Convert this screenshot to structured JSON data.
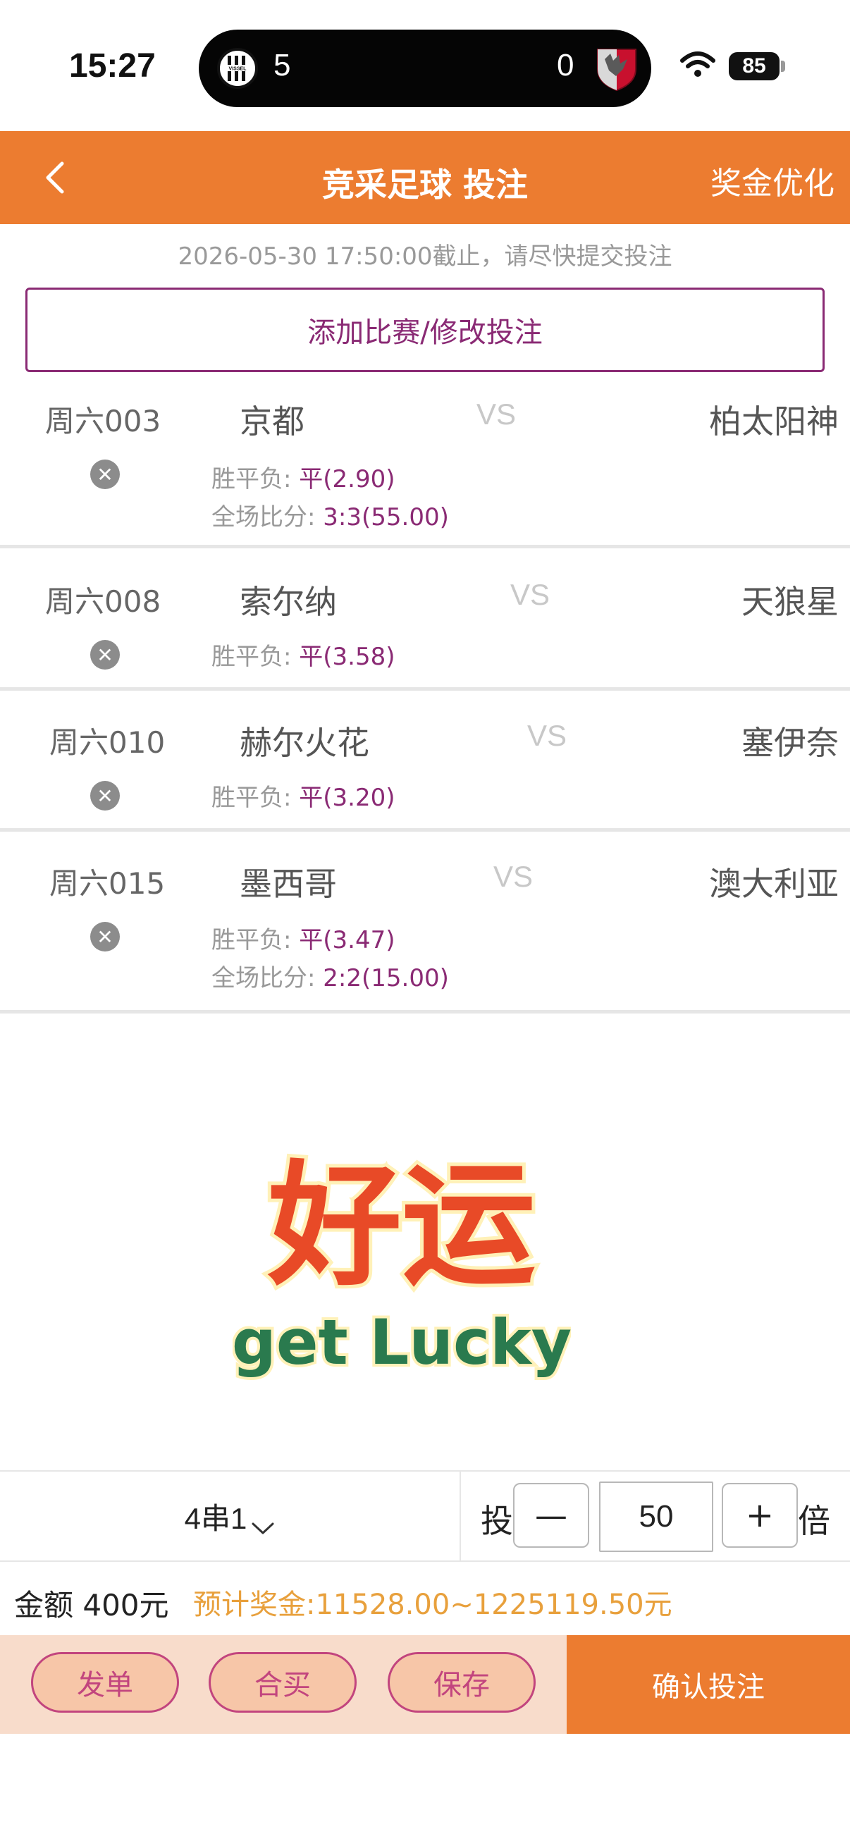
{
  "status_bar": {
    "time": "15:27",
    "live_score_left": "5",
    "live_score_right": "0",
    "battery": "85",
    "home_crest_text": "VISSEL"
  },
  "nav": {
    "title": "竞采足球 投注",
    "right_action": "奖金优化"
  },
  "deadline_text": "2026-05-30 17:50:00截止，请尽快提交投注",
  "add_match_label": "添加比赛/修改投注",
  "matches": [
    {
      "code": "周六003",
      "home": "京都",
      "vs": "VS",
      "away": "柏太阳神",
      "lines": [
        {
          "label": "胜平负: ",
          "pick": "平(2.90)"
        },
        {
          "label": "全场比分: ",
          "pick": "3:3(55.00)"
        }
      ]
    },
    {
      "code": "周六008",
      "home": "索尔纳",
      "vs": "VS",
      "away": "天狼星",
      "lines": [
        {
          "label": "胜平负: ",
          "pick": "平(3.58)"
        }
      ]
    },
    {
      "code": "周六010",
      "home": "赫尔火花",
      "vs": "VS",
      "away": "塞伊奈",
      "lines": [
        {
          "label": "胜平负: ",
          "pick": "平(3.20)"
        }
      ]
    },
    {
      "code": "周六015",
      "home": "墨西哥",
      "vs": "VS",
      "away": "澳大利亚",
      "lines": [
        {
          "label": "胜平负: ",
          "pick": "平(3.47)"
        },
        {
          "label": "全场比分: ",
          "pick": "2:2(15.00)"
        }
      ]
    }
  ],
  "luck_image": {
    "main_text": "好运",
    "sub_text": "get Lucky"
  },
  "bet_controls": {
    "combo": "4串1",
    "tou_label": "投",
    "minus": "—",
    "multiplier": "50",
    "plus": "+",
    "bei_label": "倍"
  },
  "summary": {
    "amount": "金额 400元",
    "prize": "预计奖金:11528.00~1225119.50元"
  },
  "actions": {
    "publish": "发单",
    "joint_buy": "合买",
    "save": "保存",
    "confirm": "确认投注"
  },
  "colors": {
    "brand_orange": "#ec7c30",
    "pick_purple": "#8a2a74",
    "prize_gold": "#e8a03c",
    "action_pink": "#c2457e"
  }
}
